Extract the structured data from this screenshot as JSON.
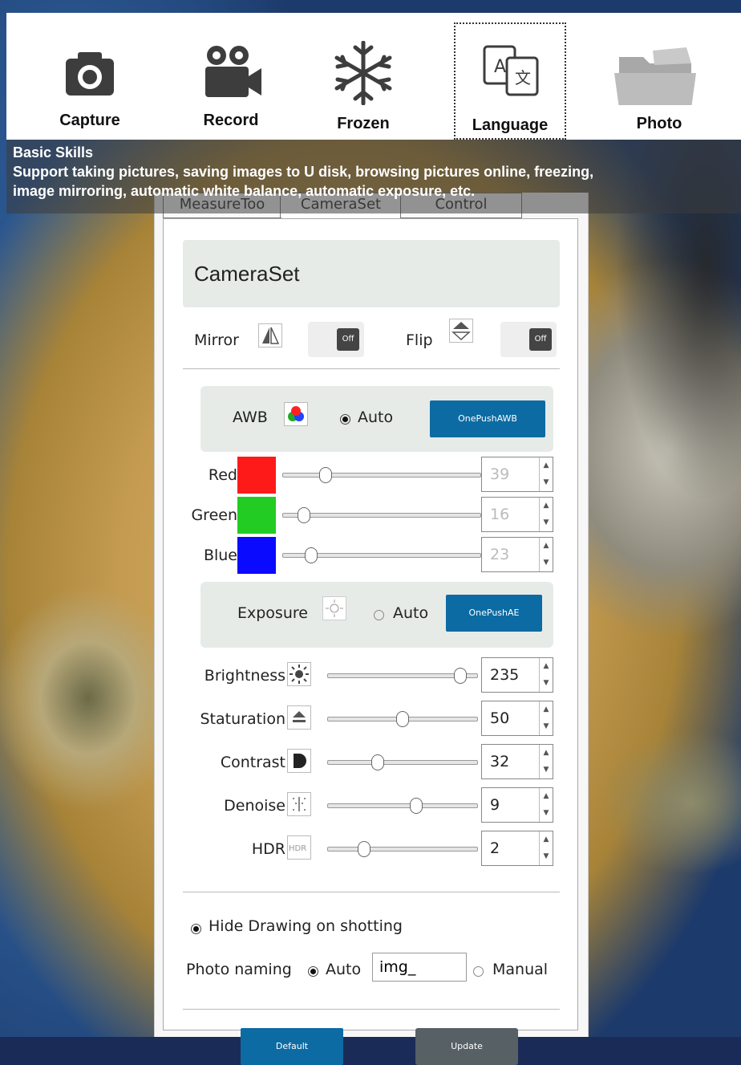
{
  "toolbar": {
    "items": [
      {
        "label": "Capture",
        "icon": "camera-icon"
      },
      {
        "label": "Record",
        "icon": "video-camera-icon"
      },
      {
        "label": "Frozen",
        "icon": "snowflake-icon"
      },
      {
        "label": "Language",
        "icon": "translate-icon"
      },
      {
        "label": "Photo",
        "icon": "folder-icon"
      }
    ]
  },
  "caption": {
    "title": "Basic Skills",
    "line1": "Support taking pictures, saving images to U disk, browsing pictures online, freezing,",
    "line2": "image mirroring, automatic white balance, automatic exposure, etc."
  },
  "tabs": [
    "MeasureToo",
    "CameraSet",
    "Control"
  ],
  "panel": {
    "title": "CameraSet",
    "mirror_label": "Mirror",
    "mirror_toggle": "Off",
    "flip_label": "Flip",
    "flip_toggle": "Off",
    "awb_label": "AWB",
    "awb_auto_label": "Auto",
    "awb_button": "OnePushAWB",
    "channels": [
      {
        "label": "Red",
        "value": "39",
        "color": "#ff1a1a",
        "level": 0.2
      },
      {
        "label": "Green",
        "value": "16",
        "color": "#22cc22",
        "level": 0.08
      },
      {
        "label": "Blue",
        "value": "23",
        "color": "#0a0aff",
        "level": 0.12
      }
    ],
    "exposure_label": "Exposure",
    "exposure_auto_label": "Auto",
    "exposure_button": "OnePushAE",
    "adjust": [
      {
        "label": "Brightness",
        "value": "235",
        "icon": "brightness-icon",
        "level": 0.92
      },
      {
        "label": "Staturation",
        "value": "50",
        "icon": "saturation-icon",
        "level": 0.5
      },
      {
        "label": "Contrast",
        "value": "32",
        "icon": "contrast-icon",
        "level": 0.32
      },
      {
        "label": "Denoise",
        "value": "9",
        "icon": "denoise-icon",
        "level": 0.6
      },
      {
        "label": "HDR",
        "value": "2",
        "icon": "hdr-icon",
        "level": 0.22
      }
    ],
    "hdr_icon_text": "HDR",
    "hide_drawing_label": "Hide Drawing on shotting",
    "photo_naming_label": "Photo naming",
    "naming_auto_label": "Auto",
    "naming_input_value": "img_",
    "naming_manual_label": "Manual",
    "default_button": "Default",
    "update_button": "Update"
  }
}
